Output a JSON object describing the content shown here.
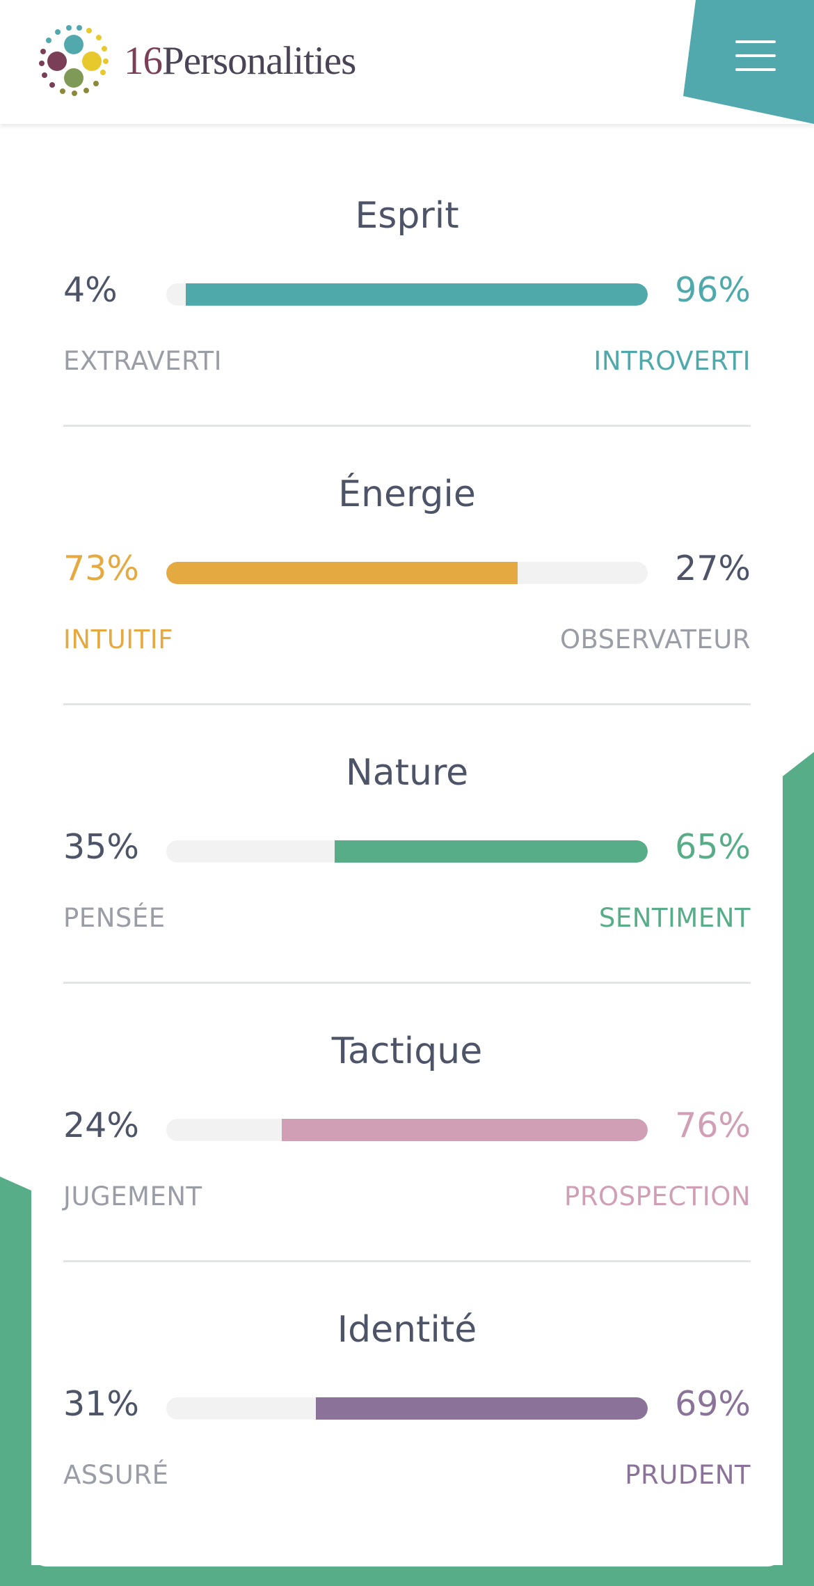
{
  "header": {
    "logo_number": "16",
    "logo_word": "Personalities",
    "menu_icon": "hamburger-menu-icon",
    "menu_color": "#51a9ad"
  },
  "colors": {
    "background_green": "#56ad88",
    "track": "#f2f2f2",
    "neutral_text": "#4e5468",
    "muted_label": "#9a9ca6"
  },
  "traits": [
    {
      "title": "Esprit",
      "left_pct": "4%",
      "right_pct": "96%",
      "left_label": "EXTRAVERTI",
      "right_label": "INTROVERTI",
      "dominant": "right",
      "value": 0.96,
      "color": "#4fa9ab"
    },
    {
      "title": "Énergie",
      "left_pct": "73%",
      "right_pct": "27%",
      "left_label": "INTUITIF",
      "right_label": "OBSERVATEUR",
      "dominant": "left",
      "value": 0.73,
      "color": "#e4a940"
    },
    {
      "title": "Nature",
      "left_pct": "35%",
      "right_pct": "65%",
      "left_label": "PENSÉE",
      "right_label": "SENTIMENT",
      "dominant": "right",
      "value": 0.65,
      "color": "#56ad88"
    },
    {
      "title": "Tactique",
      "left_pct": "24%",
      "right_pct": "76%",
      "left_label": "JUGEMENT",
      "right_label": "PROSPECTION",
      "dominant": "right",
      "value": 0.76,
      "color": "#d19fb5"
    },
    {
      "title": "Identité",
      "left_pct": "31%",
      "right_pct": "69%",
      "left_label": "ASSURÉ",
      "right_label": "PRUDENT",
      "dominant": "right",
      "value": 0.69,
      "color": "#8a7299"
    }
  ]
}
